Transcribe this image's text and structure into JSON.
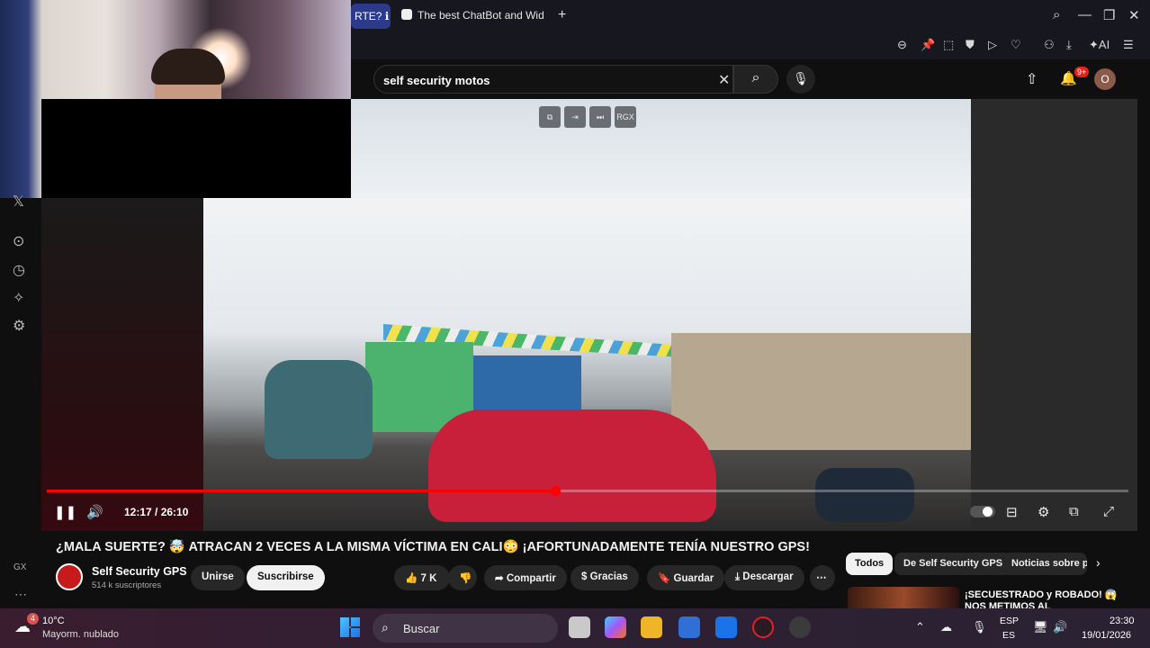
{
  "browser": {
    "active_tab_label": "RTE? ℹ",
    "tab2_label": "The best ChatBot and Wid",
    "new_tab_icon": "+",
    "ai_label": "AI"
  },
  "youtube": {
    "search": {
      "value": "self security motos",
      "placeholder": "Buscar"
    },
    "notifications_badge": "9+",
    "avatar_letter": "O"
  },
  "player": {
    "time": "12:17 / 26:10",
    "progress_fraction": 0.47,
    "mini_controls": [
      "⧉",
      "⇥",
      "⏭",
      "RGX"
    ]
  },
  "video": {
    "title": "¿MALA SUERTE? 🤯 ATRACAN 2 VECES A LA MISMA VÍCTIMA EN CALI😳 ¡AFORTUNADAMENTE TENÍA NUESTRO GPS!",
    "channel_name": "Self Security GPS",
    "channel_subs": "514 k suscriptores",
    "join_label": "Unirse",
    "subscribe_label": "Suscribirse",
    "like_count": "7 K",
    "share_label": "Compartir",
    "thanks_label": "Gracias",
    "save_label": "Guardar",
    "download_label": "Descargar"
  },
  "recommendations": {
    "chips": [
      "Todos",
      "De Self Security GPS",
      "Noticias sobre p"
    ],
    "first_title": "¡SECUESTRADO y ROBADO! 😱",
    "first_title_line2": "NOS METIMOS AL"
  },
  "sidebar": {
    "gx_label": "GX"
  },
  "taskbar": {
    "weather_temp": "10°C",
    "weather_desc": "Mayorm. nublado",
    "weather_badge": "4",
    "search_label": "Buscar",
    "lang_top": "ESP",
    "lang_bottom": "ES",
    "time": "23:30",
    "date": "19/01/2026"
  },
  "colors": {
    "accent_red": "#ff0000",
    "tab_active": "#2c3a8c"
  }
}
